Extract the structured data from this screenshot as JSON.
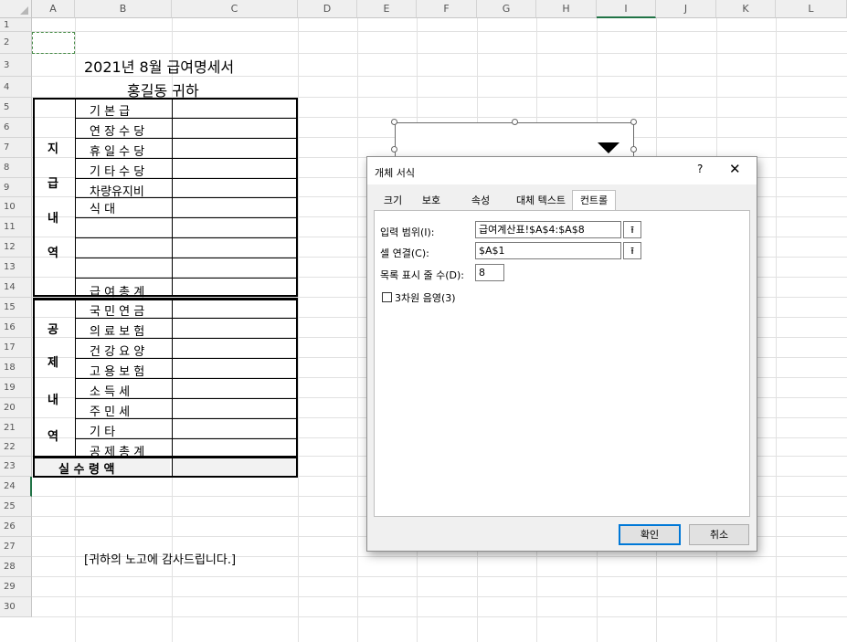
{
  "columns": [
    "A",
    "B",
    "C",
    "D",
    "E",
    "F",
    "G",
    "H",
    "I",
    "J",
    "K",
    "L"
  ],
  "rows": [
    "1",
    "2",
    "3",
    "4",
    "5",
    "6",
    "7",
    "8",
    "9",
    "10",
    "11",
    "12",
    "13",
    "14",
    "15",
    "16",
    "17",
    "18",
    "19",
    "20",
    "21",
    "22",
    "23",
    "24",
    "25",
    "26",
    "27",
    "28",
    "29",
    "30"
  ],
  "sheet": {
    "title": "2021년 8월 급여명세서",
    "recipient": "홍길동 귀하",
    "pay_group_label": [
      "지",
      "급",
      "내",
      "역"
    ],
    "pay_items": [
      "기 본 급",
      "연 장 수 당",
      "휴 일 수 당",
      "기 타 수 당",
      "차량유지비",
      "식 대"
    ],
    "pay_total": "급 여 총 계",
    "deduct_group_label": [
      "공",
      "제",
      "내",
      "역"
    ],
    "deduct_items": [
      "국 민 연 금",
      "의 료 보 험",
      "건 강 요 양",
      "고 용 보 험",
      "소 득 세",
      "주 민 세",
      "기 타"
    ],
    "deduct_total": "공 제 총 계",
    "net_pay": "실 수 령 액",
    "thanks": "[귀하의 노고에 감사드립니다.]"
  },
  "dialog": {
    "title": "개체 서식",
    "help": "?",
    "close": "✕",
    "tabs": [
      "크기",
      "보호",
      "속성",
      "대체 텍스트",
      "컨트롤"
    ],
    "active_tab": "컨트롤",
    "input_range_label": "입력 범위(I):",
    "input_range_value": "급여계산표!$A$4:$A$8",
    "cell_link_label": "셀 연결(C):",
    "cell_link_value": "$A$1",
    "dropdown_lines_label": "목록 표시 줄 수(D):",
    "dropdown_lines_value": "8",
    "shading_3d_label": "3차원 음영(3)",
    "ok": "확인",
    "cancel": "취소",
    "pick_icon": "⭱"
  }
}
